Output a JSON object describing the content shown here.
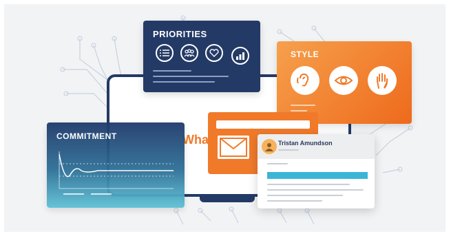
{
  "cards": {
    "priorities": {
      "title": "PRIORITIES",
      "icons": [
        "list-icon",
        "people-icon",
        "heart-icon",
        "bar-chart-icon"
      ]
    },
    "style": {
      "title": "STYLE",
      "icons": [
        "ear-icon",
        "eye-icon",
        "hand-icon"
      ]
    },
    "commitment": {
      "title": "COMMITMENT"
    },
    "profile": {
      "name": "Tristan Amundson"
    }
  },
  "monitor": {
    "partial_text": "What"
  },
  "colors": {
    "navy": "#243a66",
    "orange": "#f07a2a",
    "teal": "#3bb5d6",
    "background": "#f2f3f5"
  }
}
